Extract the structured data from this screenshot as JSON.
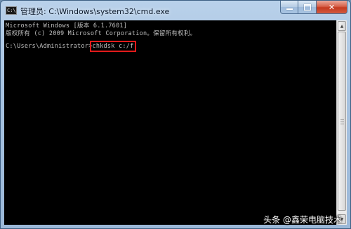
{
  "window": {
    "title": "管理员: C:\\Windows\\system32\\cmd.exe",
    "app_icon": "cmd-icon",
    "app_icon_text": "C:\\",
    "caption_buttons": [
      "minimize-icon",
      "maximize-icon",
      "close-icon"
    ],
    "close_glyph": "✕"
  },
  "console": {
    "line1": "Microsoft Windows [版本 6.1.7601]",
    "line2": "版权所有 (c) 2009 Microsoft Corporation。保留所有权利。",
    "prompt": "C:\\Users\\Administrator>",
    "command": "chkdsk c:/f",
    "highlight_color": "#e21b1b",
    "text_color": "#c0c0c0",
    "background": "#000000"
  },
  "scrollbar": {
    "up_glyph": "▲",
    "down_glyph": "▼"
  },
  "watermark": {
    "text": "头条 @鑫荣电脑技术"
  }
}
